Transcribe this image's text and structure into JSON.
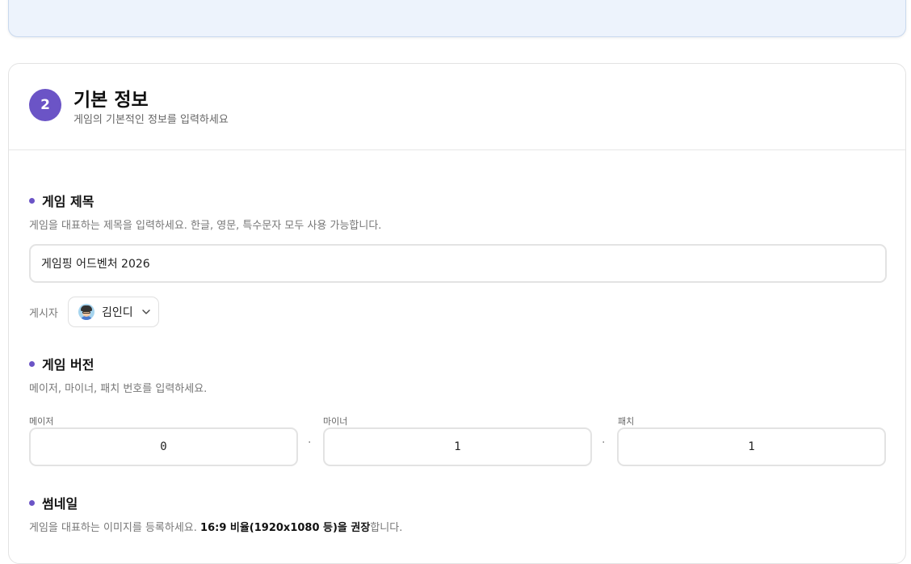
{
  "basic_info": {
    "step_number": "2",
    "title": "기본 정보",
    "subtitle": "게임의 기본적인 정보를 입력하세요"
  },
  "game_title": {
    "label": "게임 제목",
    "description": "게임을 대표하는 제목을 입력하세요. 한글, 영문, 특수문자 모두 사용 가능합니다.",
    "value": "게임핑 어드벤처 2026"
  },
  "publisher": {
    "label": "게시자",
    "name": "김인디",
    "avatar_icon": "developer-avatar-icon"
  },
  "game_version": {
    "label": "게임 버전",
    "description": "메이저, 마이너, 패치 번호를 입력하세요.",
    "major_label": "메이저",
    "major_value": "0",
    "minor_label": "마이너",
    "minor_value": "1",
    "patch_label": "패치",
    "patch_value": "1",
    "separator": "."
  },
  "thumbnail": {
    "label": "썸네일",
    "description_prefix": "게임을 대표하는 이미지를 등록하세요. ",
    "description_bold": "16:9 비율(1920x1080 등)을 권장",
    "description_suffix": "합니다."
  },
  "colors": {
    "accent": "#6b54c6",
    "previous_card_bg": "#edf3fc"
  }
}
